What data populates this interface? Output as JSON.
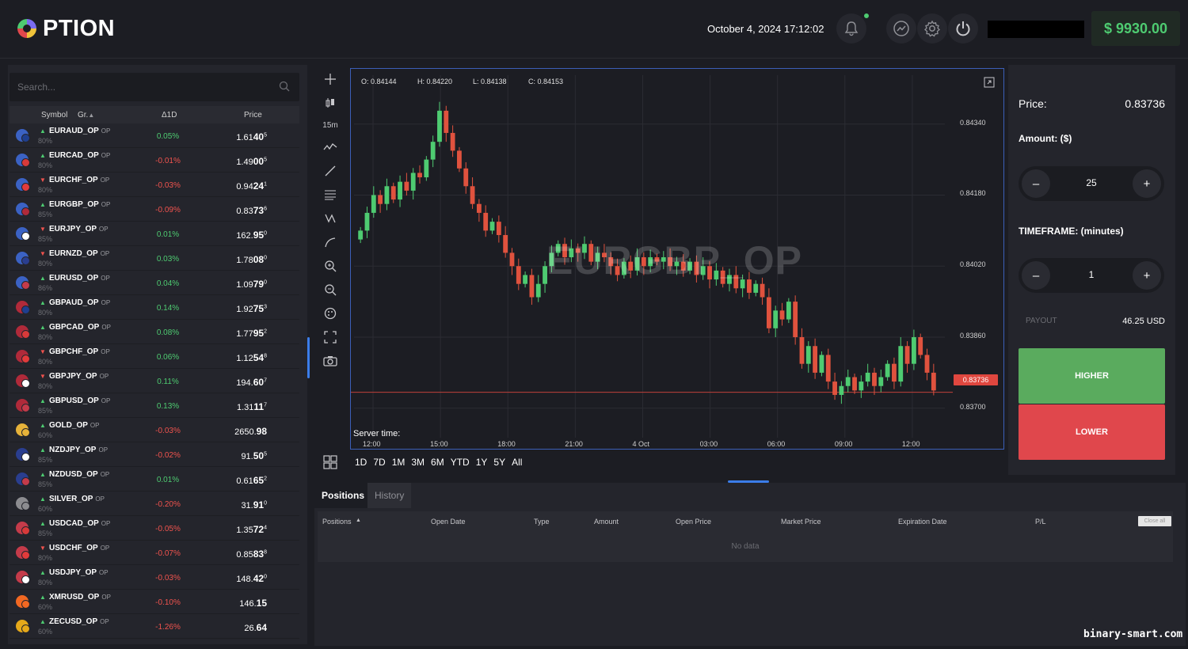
{
  "app": {
    "logo_text": "PTION",
    "datetime": "October 4, 2024 17:12:02",
    "balance": "$ 9930.00"
  },
  "search": {
    "placeholder": "Search..."
  },
  "table": {
    "col_symbol": "Symbol",
    "col_group": "Gr.",
    "col_change": "Δ1D",
    "col_price": "Price",
    "rows": [
      {
        "symbol": "EURAUD_OP",
        "tag": "OP",
        "pct": "80%",
        "dir": "up",
        "change": "0.05%",
        "p_main": "1.61",
        "p_big": "40",
        "p_sup": "5",
        "f1": "#3b62c4",
        "f2": "#1f3f8f"
      },
      {
        "symbol": "EURCAD_OP",
        "tag": "OP",
        "pct": "80%",
        "dir": "up",
        "change": "-0.01%",
        "p_main": "1.49",
        "p_big": "00",
        "p_sup": "5",
        "f1": "#3b62c4",
        "f2": "#d83a3a"
      },
      {
        "symbol": "EURCHF_OP",
        "tag": "OP",
        "pct": "80%",
        "dir": "down",
        "change": "-0.03%",
        "p_main": "0.94",
        "p_big": "24",
        "p_sup": "1",
        "f1": "#3b62c4",
        "f2": "#e23b3b"
      },
      {
        "symbol": "EURGBP_OP",
        "tag": "OP",
        "pct": "85%",
        "dir": "up",
        "change": "-0.09%",
        "p_main": "0.83",
        "p_big": "73",
        "p_sup": "6",
        "f1": "#3b62c4",
        "f2": "#b02a3a"
      },
      {
        "symbol": "EURJPY_OP",
        "tag": "OP",
        "pct": "85%",
        "dir": "down",
        "change": "0.01%",
        "p_main": "162.",
        "p_big": "95",
        "p_sup": "0",
        "f1": "#3b62c4",
        "f2": "#ffffff"
      },
      {
        "symbol": "EURNZD_OP",
        "tag": "OP",
        "pct": "80%",
        "dir": "down",
        "change": "0.03%",
        "p_main": "1.78",
        "p_big": "08",
        "p_sup": "0",
        "f1": "#3b62c4",
        "f2": "#2a3e8f"
      },
      {
        "symbol": "EURUSD_OP",
        "tag": "OP",
        "pct": "86%",
        "dir": "up",
        "change": "0.04%",
        "p_main": "1.09",
        "p_big": "79",
        "p_sup": "0",
        "f1": "#3b62c4",
        "f2": "#c43b4a"
      },
      {
        "symbol": "GBPAUD_OP",
        "tag": "OP",
        "pct": "80%",
        "dir": "up",
        "change": "0.14%",
        "p_main": "1.92",
        "p_big": "75",
        "p_sup": "3",
        "f1": "#b02a3a",
        "f2": "#1f3f8f"
      },
      {
        "symbol": "GBPCAD_OP",
        "tag": "OP",
        "pct": "80%",
        "dir": "up",
        "change": "0.08%",
        "p_main": "1.77",
        "p_big": "95",
        "p_sup": "2",
        "f1": "#b02a3a",
        "f2": "#d83a3a"
      },
      {
        "symbol": "GBPCHF_OP",
        "tag": "OP",
        "pct": "80%",
        "dir": "down",
        "change": "0.06%",
        "p_main": "1.12",
        "p_big": "54",
        "p_sup": "8",
        "f1": "#b02a3a",
        "f2": "#e23b3b"
      },
      {
        "symbol": "GBPJPY_OP",
        "tag": "OP",
        "pct": "80%",
        "dir": "down",
        "change": "0.11%",
        "p_main": "194.",
        "p_big": "60",
        "p_sup": "7",
        "f1": "#b02a3a",
        "f2": "#ffffff"
      },
      {
        "symbol": "GBPUSD_OP",
        "tag": "OP",
        "pct": "85%",
        "dir": "up",
        "change": "0.13%",
        "p_main": "1.31",
        "p_big": "11",
        "p_sup": "7",
        "f1": "#b02a3a",
        "f2": "#c43b4a"
      },
      {
        "symbol": "GOLD_OP",
        "tag": "OP",
        "pct": "60%",
        "dir": "up",
        "change": "-0.03%",
        "p_main": "2650.",
        "p_big": "98",
        "p_sup": "",
        "f1": "#e6b23a",
        "f2": "#e6b23a"
      },
      {
        "symbol": "NZDJPY_OP",
        "tag": "OP",
        "pct": "85%",
        "dir": "up",
        "change": "-0.02%",
        "p_main": "91.",
        "p_big": "50",
        "p_sup": "5",
        "f1": "#2a3e8f",
        "f2": "#ffffff"
      },
      {
        "symbol": "NZDUSD_OP",
        "tag": "OP",
        "pct": "85%",
        "dir": "up",
        "change": "0.01%",
        "p_main": "0.61",
        "p_big": "65",
        "p_sup": "2",
        "f1": "#2a3e8f",
        "f2": "#c43b4a"
      },
      {
        "symbol": "SILVER_OP",
        "tag": "OP",
        "pct": "60%",
        "dir": "up",
        "change": "-0.20%",
        "p_main": "31.",
        "p_big": "91",
        "p_sup": "0",
        "f1": "#8c8c90",
        "f2": "#8c8c90"
      },
      {
        "symbol": "USDCAD_OP",
        "tag": "OP",
        "pct": "85%",
        "dir": "up",
        "change": "-0.05%",
        "p_main": "1.35",
        "p_big": "72",
        "p_sup": "4",
        "f1": "#c43b4a",
        "f2": "#d83a3a"
      },
      {
        "symbol": "USDCHF_OP",
        "tag": "OP",
        "pct": "80%",
        "dir": "down",
        "change": "-0.07%",
        "p_main": "0.85",
        "p_big": "83",
        "p_sup": "8",
        "f1": "#c43b4a",
        "f2": "#e23b3b"
      },
      {
        "symbol": "USDJPY_OP",
        "tag": "OP",
        "pct": "80%",
        "dir": "up",
        "change": "-0.03%",
        "p_main": "148.",
        "p_big": "42",
        "p_sup": "0",
        "f1": "#c43b4a",
        "f2": "#ffffff"
      },
      {
        "symbol": "XMRUSD_OP",
        "tag": "OP",
        "pct": "60%",
        "dir": "up",
        "change": "-0.10%",
        "p_main": "146.",
        "p_big": "15",
        "p_sup": "",
        "f1": "#f26822",
        "f2": "#f26822"
      },
      {
        "symbol": "ZECUSD_OP",
        "tag": "OP",
        "pct": "60%",
        "dir": "up",
        "change": "-1.26%",
        "p_main": "26.",
        "p_big": "64",
        "p_sup": "",
        "f1": "#e6a91a",
        "f2": "#e6a91a"
      }
    ]
  },
  "chart": {
    "symbol": "EURGBP_OP",
    "ohlc": {
      "o": "O: 0.84144",
      "h": "H: 0.84220",
      "l": "L: 0.84138",
      "c": "C: 0.84153"
    },
    "interval": "15m",
    "server_time_label": "Server time:",
    "current_price_tag": "0.83736",
    "ranges": [
      "1D",
      "7D",
      "1M",
      "3M",
      "6M",
      "YTD",
      "1Y",
      "5Y",
      "All"
    ]
  },
  "chart_data": {
    "type": "candlestick",
    "y_ticks": [
      "0.84340",
      "0.84180",
      "0.84020",
      "0.83860",
      "0.83700"
    ],
    "x_ticks": [
      "12:00",
      "15:00",
      "18:00",
      "21:00",
      "4 Oct",
      "03:00",
      "06:00",
      "09:00",
      "12:00"
    ],
    "ylim": [
      0.8368,
      0.8445
    ],
    "current_price": 0.83736,
    "close_series": [
      0.841,
      0.8414,
      0.8418,
      0.8416,
      0.842,
      0.8417,
      0.8421,
      0.8419,
      0.8423,
      0.8422,
      0.8426,
      0.843,
      0.8437,
      0.8432,
      0.8428,
      0.8424,
      0.842,
      0.8416,
      0.8414,
      0.841,
      0.8412,
      0.8409,
      0.8405,
      0.8402,
      0.8398,
      0.84,
      0.8395,
      0.8398,
      0.8402,
      0.8405,
      0.8407,
      0.8404,
      0.8406,
      0.8405,
      0.8407,
      0.8403,
      0.8405,
      0.8404,
      0.8402,
      0.84,
      0.8403,
      0.8401,
      0.8404,
      0.8402,
      0.8404,
      0.8403,
      0.8404,
      0.8402,
      0.8403,
      0.8401,
      0.8403,
      0.84,
      0.8402,
      0.8399,
      0.8401,
      0.8398,
      0.84,
      0.8397,
      0.8399,
      0.8396,
      0.8398,
      0.8395,
      0.8388,
      0.8392,
      0.839,
      0.8394,
      0.8386,
      0.838,
      0.8384,
      0.8378,
      0.8382,
      0.8376,
      0.8373,
      0.8375,
      0.8377,
      0.8374,
      0.8376,
      0.8378,
      0.8375,
      0.8377,
      0.838,
      0.8376,
      0.8384,
      0.838,
      0.8386,
      0.8382,
      0.8378,
      0.8374
    ]
  },
  "trade": {
    "price_label": "Price:",
    "price_value": "0.83736",
    "amount_label": "Amount: ($)",
    "amount_value": "25",
    "timeframe_label": "TIMEFRAME: (minutes)",
    "timeframe_value": "1",
    "payout_label": "PAYOUT",
    "payout_value": "46.25 USD",
    "higher": "HIGHER",
    "lower": "LOWER"
  },
  "positions": {
    "tab_positions": "Positions",
    "tab_history": "History",
    "cols": [
      "Positions",
      "Open Date",
      "Type",
      "Amount",
      "Open Price",
      "Market Price",
      "Expiration Date",
      "P/L"
    ],
    "close_all": "Close all",
    "empty": "No data"
  },
  "watermark_site": "binary-smart.com",
  "colors": {
    "up": "#4ecb71",
    "down": "#f0534e",
    "accent": "#3b7de9",
    "higher": "#5aab5e",
    "lower": "#e0474c"
  }
}
